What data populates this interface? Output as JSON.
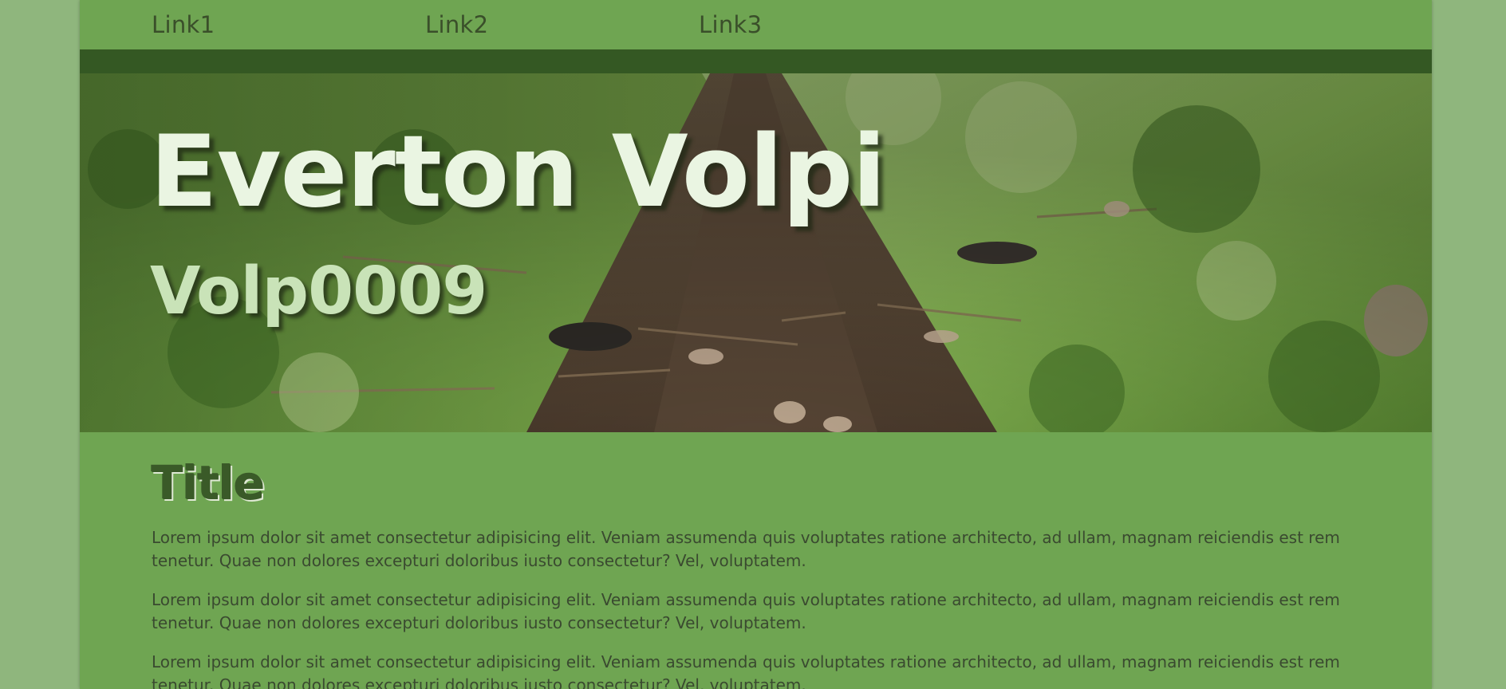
{
  "nav": {
    "links": [
      "Link1",
      "Link2",
      "Link3"
    ]
  },
  "hero": {
    "title": "Everton Volpi",
    "subtitle": "Volp0009"
  },
  "main": {
    "title": "Title",
    "paragraphs": [
      "Lorem ipsum dolor sit amet consectetur adipisicing elit. Veniam assumenda quis voluptates ratione architecto, ad ullam, magnam reiciendis est rem tenetur. Quae non dolores excepturi doloribus iusto consectetur? Vel, voluptatem.",
      "Lorem ipsum dolor sit amet consectetur adipisicing elit. Veniam assumenda quis voluptates ratione architecto, ad ullam, magnam reiciendis est rem tenetur. Quae non dolores excepturi doloribus iusto consectetur? Vel, voluptatem.",
      "Lorem ipsum dolor sit amet consectetur adipisicing elit. Veniam assumenda quis voluptates ratione architecto, ad ullam, magnam reiciendis est rem tenetur. Quae non dolores excepturi doloribus iusto consectetur? Vel, voluptatem."
    ]
  },
  "colors": {
    "page_bg": "#8fb67d",
    "content_bg": "#6fa552",
    "nav_bar": "#345823",
    "hero_title": "#eaf5e2",
    "hero_subtitle": "#c9e3b8"
  }
}
